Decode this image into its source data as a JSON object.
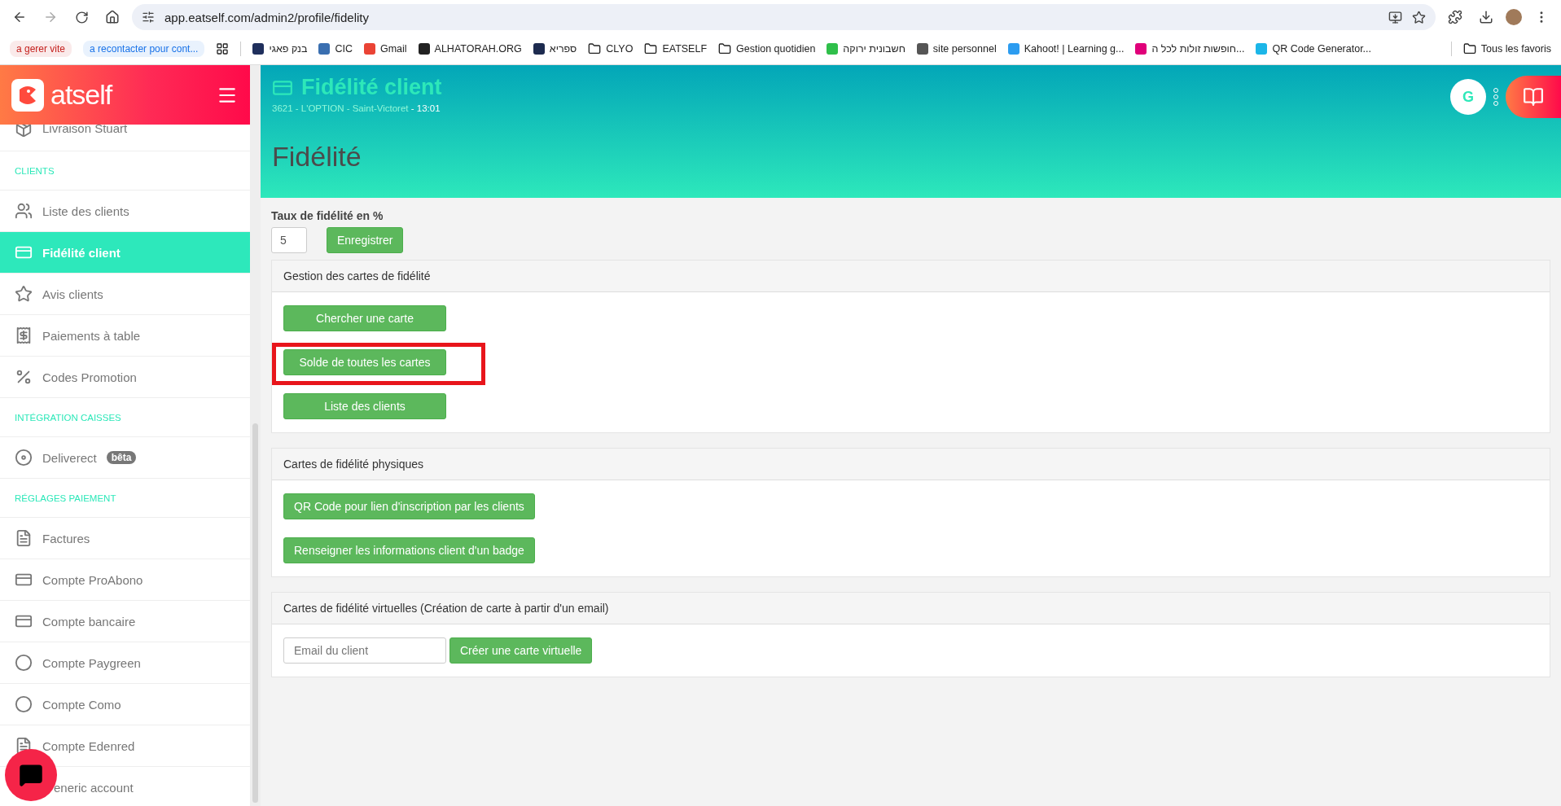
{
  "browser": {
    "url": "app.eatself.com/admin2/profile/fidelity",
    "bookmarks": [
      {
        "kind": "chip",
        "label": "a gerer vite",
        "color": "#c5221f"
      },
      {
        "kind": "chip",
        "label": "a recontacter pour cont...",
        "color": "#1a73e8"
      },
      {
        "kind": "apps"
      },
      {
        "kind": "site",
        "label": "בנק פאגי",
        "color": "#1f2f5c"
      },
      {
        "kind": "site",
        "label": "CIC",
        "color": "#3a6fb0"
      },
      {
        "kind": "site",
        "label": "Gmail",
        "color": "#ea4335"
      },
      {
        "kind": "site",
        "label": "ALHATORAH.ORG",
        "color": "#222222"
      },
      {
        "kind": "site",
        "label": "ספריא",
        "color": "#1d2b4f"
      },
      {
        "kind": "folder",
        "label": "CLYO"
      },
      {
        "kind": "folder",
        "label": "EATSELF"
      },
      {
        "kind": "folder",
        "label": "Gestion quotidien"
      },
      {
        "kind": "site",
        "label": "חשבונית ירוקה",
        "color": "#2fbf4a"
      },
      {
        "kind": "site",
        "label": "site personnel",
        "color": "#555555"
      },
      {
        "kind": "site",
        "label": "Kahoot! | Learning g...",
        "color": "#2c9cf0"
      },
      {
        "kind": "site",
        "label": "חופשות זולות לכל ה...",
        "color": "#e0007a"
      },
      {
        "kind": "site",
        "label": "QR Code Generator...",
        "color": "#1bb6e8"
      }
    ],
    "all_bookmarks": "Tous les favoris"
  },
  "sidebar": {
    "logo": "atself",
    "items": [
      {
        "kind": "item",
        "label": "Livraison Stuart",
        "selected": false
      },
      {
        "kind": "section",
        "label": "CLIENTS"
      },
      {
        "kind": "item",
        "label": "Liste des clients",
        "selected": false
      },
      {
        "kind": "item",
        "label": "Fidélité client",
        "selected": true
      },
      {
        "kind": "item",
        "label": "Avis clients",
        "selected": false
      },
      {
        "kind": "item",
        "label": "Paiements à table",
        "selected": false
      },
      {
        "kind": "item",
        "label": "Codes Promotion",
        "selected": false
      },
      {
        "kind": "section",
        "label": "INTÉGRATION CAISSES"
      },
      {
        "kind": "item",
        "label": "Deliverect",
        "badge": "bêta",
        "selected": false
      },
      {
        "kind": "section",
        "label": "RÉGLAGES PAIEMENT"
      },
      {
        "kind": "item",
        "label": "Factures",
        "selected": false
      },
      {
        "kind": "item",
        "label": "Compte ProAbono",
        "selected": false
      },
      {
        "kind": "item",
        "label": "Compte bancaire",
        "selected": false
      },
      {
        "kind": "item",
        "label": "Compte Paygreen",
        "selected": false
      },
      {
        "kind": "item",
        "label": "Compte Como",
        "selected": false
      },
      {
        "kind": "item",
        "label": "Compte Edenred",
        "selected": false
      },
      {
        "kind": "item",
        "label": "eneric account",
        "selected": false
      }
    ]
  },
  "header": {
    "title": "Fidélité client",
    "location": "3621 - L'OPTION - Saint-Victoret",
    "time": " - 13:01",
    "avatar": "G",
    "page_title": "Fidélité"
  },
  "rate": {
    "label": "Taux de fidélité en %",
    "value": "5",
    "button": "Enregistrer"
  },
  "cards": [
    {
      "kind": "buttons",
      "title": "Gestion des cartes de fidélité",
      "buttons": [
        {
          "label": "Chercher une carte",
          "highlighted": false
        },
        {
          "label": "Solde de toutes les cartes",
          "highlighted": true
        },
        {
          "label": "Liste des clients",
          "highlighted": false
        }
      ]
    },
    {
      "kind": "buttons",
      "title": "Cartes de fidélité physiques",
      "buttons": [
        {
          "label": "QR Code pour lien d'inscription par les clients",
          "highlighted": false
        },
        {
          "label": "Renseigner les informations client d'un badge",
          "highlighted": false
        }
      ]
    },
    {
      "kind": "form",
      "title": "Cartes de fidélité virtuelles (Création de carte à partir d'un email)",
      "placeholder": "Email du client",
      "button": "Créer une carte virtuelle"
    }
  ]
}
